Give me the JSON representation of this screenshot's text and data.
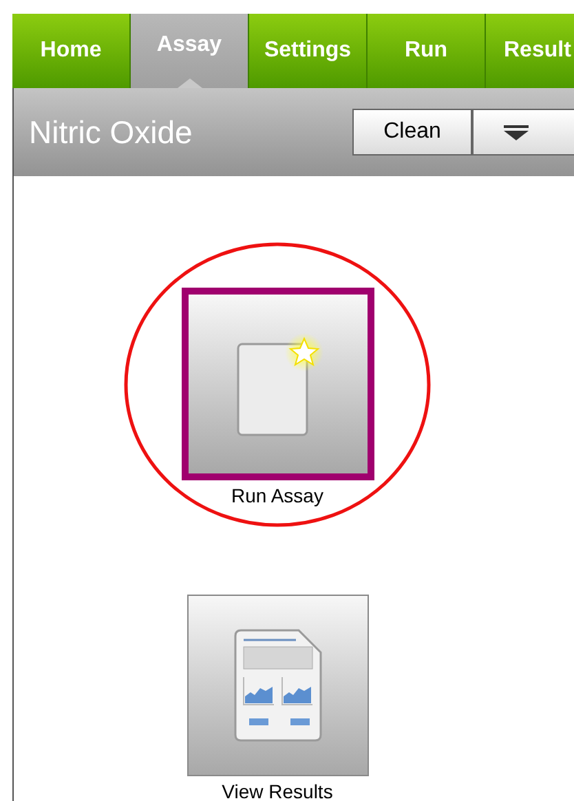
{
  "tabs": [
    {
      "label": "Home",
      "selected": false
    },
    {
      "label": "Assay",
      "selected": true
    },
    {
      "label": "Settings",
      "selected": false
    },
    {
      "label": "Run",
      "selected": false
    },
    {
      "label": "Result",
      "selected": false
    }
  ],
  "header": {
    "title": "Nitric Oxide",
    "buttons": [
      {
        "kind": "text",
        "label": "Clean"
      },
      {
        "kind": "menu"
      }
    ]
  },
  "tiles": [
    {
      "kind": "run",
      "label": "Run Assay",
      "selected": true,
      "circled": true
    },
    {
      "kind": "results",
      "label": "View Results",
      "selected": false,
      "circled": false
    }
  ]
}
